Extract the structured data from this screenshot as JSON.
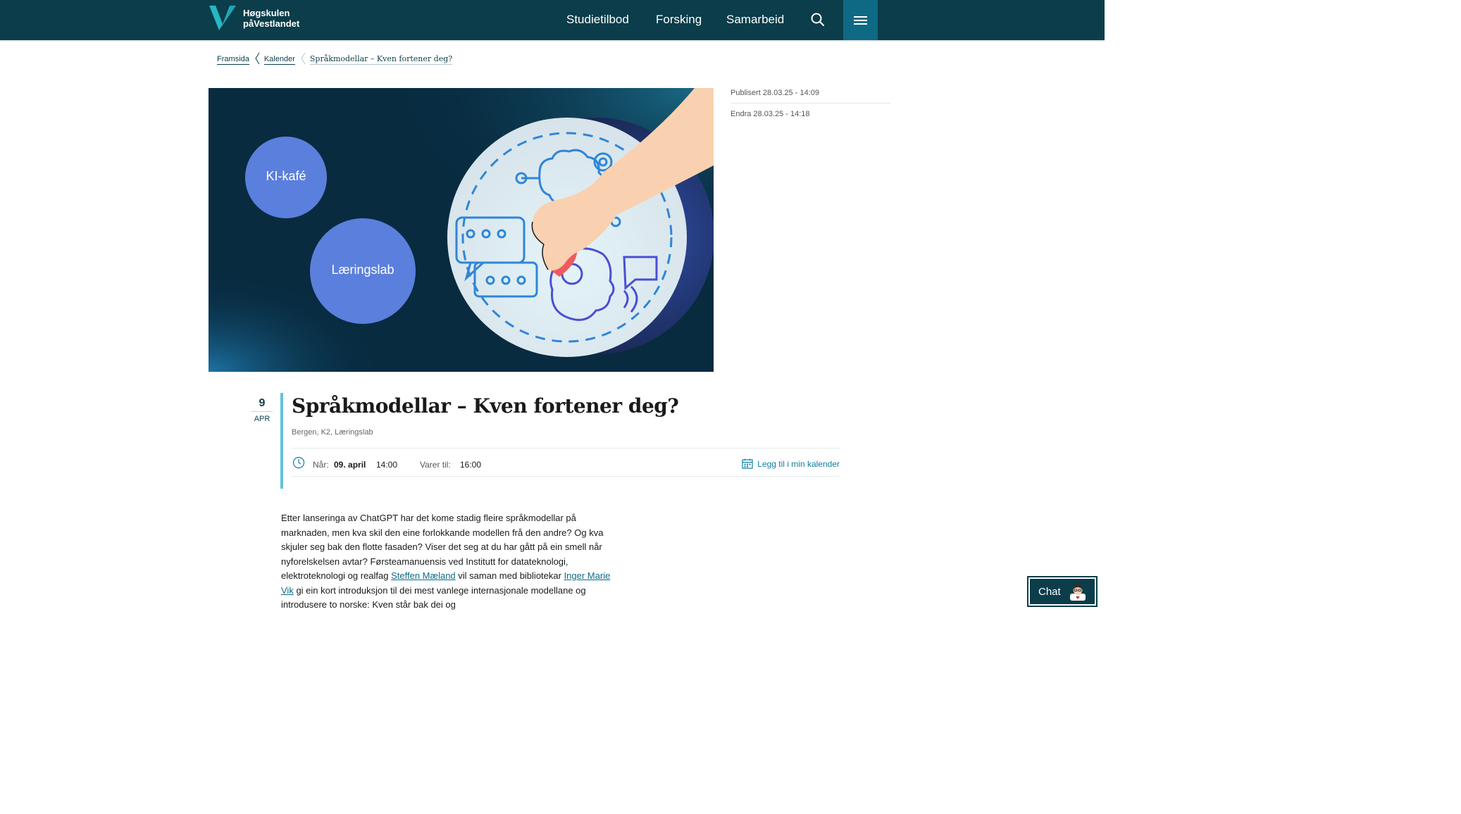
{
  "header": {
    "logo_line1": "Høgskulen",
    "logo_line2": "påVestlandet",
    "nav": [
      "Studietilbod",
      "Forsking",
      "Samarbeid"
    ],
    "search_icon": "search-icon",
    "menu_icon": "hamburger-menu-icon",
    "colors": {
      "bar": "#0b3d4a",
      "menu": "#0e6a84",
      "accent": "#27b7c4"
    }
  },
  "breadcrumb": {
    "items": [
      "Framsida",
      "Kalender"
    ],
    "current": "Språkmodellar – Kven fortener deg?"
  },
  "hero": {
    "bubble1": "KI-kafé",
    "bubble2": "Læringslab"
  },
  "meta": {
    "published": "Publisert 28.03.25 - 14:09",
    "edited": "Endra 28.03.25 - 14:18"
  },
  "event": {
    "day": "9",
    "month": "APR",
    "title": "Språkmodellar – Kven fortener deg?",
    "location": "Bergen, K2, Læringslab",
    "when_label": "Når:",
    "when_date": "09. april",
    "when_time": "14:00",
    "until_label": "Varer til:",
    "until_time": "16:00",
    "calendar_link": "Legg til i min kalender",
    "accent": "#5ec5d4"
  },
  "body": {
    "p1_a": "Etter lanseringa av ChatGPT har det kome stadig fleire språkmodellar på marknaden, men kva skil den eine forlokkande modellen frå den andre? Og kva skjuler seg bak den flotte fasaden? Viser det seg at du har gått på ein smell når nyforelskelsen avtar? Førsteamanuensis ved Institutt for datateknologi, elektroteknologi og realfag ",
    "link1": "Steffen Mæland",
    "p1_b": " vil saman med bibliotekar ",
    "link2": "Inger Marie Vik",
    "p1_c": " gi ein kort introduksjon til dei mest vanlege internasjonale modellane og introdusere to norske: Kven står bak dei og"
  },
  "chat": {
    "label": "Chat"
  }
}
